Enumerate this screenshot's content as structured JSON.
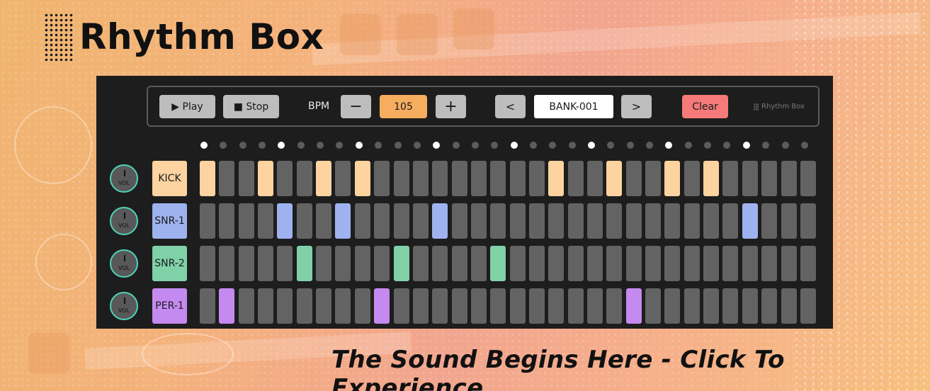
{
  "brand": {
    "title": "Rhythm Box"
  },
  "toolbar": {
    "play_label": "▶ Play",
    "stop_label": "■ Stop",
    "bpm_label": "BPM",
    "bpm_minus_label": "−",
    "bpm_value": "105",
    "bpm_plus_label": "+",
    "bank_prev_label": "<",
    "bank_name": "BANK-001",
    "bank_next_label": ">",
    "clear_label": "Clear",
    "mini_logo": "Rhythm Box"
  },
  "sequencer": {
    "step_count": 32,
    "beat_every": 4,
    "inactive_color": "#636363",
    "tracks": [
      {
        "name": "KICK",
        "knob_label": "VOL",
        "color": "#fdd3a0",
        "active": [
          0,
          3,
          6,
          8,
          18,
          21,
          24,
          26
        ]
      },
      {
        "name": "SNR-1",
        "knob_label": "VOL",
        "color": "#9eb2ef",
        "active": [
          4,
          7,
          12,
          28
        ]
      },
      {
        "name": "SNR-2",
        "knob_label": "VOL",
        "color": "#80d0a8",
        "active": [
          5,
          10,
          15
        ]
      },
      {
        "name": "PER-1",
        "knob_label": "VOL",
        "color": "#c48af0",
        "active": [
          1,
          9,
          22
        ]
      }
    ]
  },
  "colors": {
    "accent_bpm": "#f7ad5f",
    "clear": "#f57a7a",
    "knob_ring": "#4fd3b8",
    "device_bg": "#1d1d1d"
  },
  "tagline": "The Sound Begins Here - Click To Experience"
}
